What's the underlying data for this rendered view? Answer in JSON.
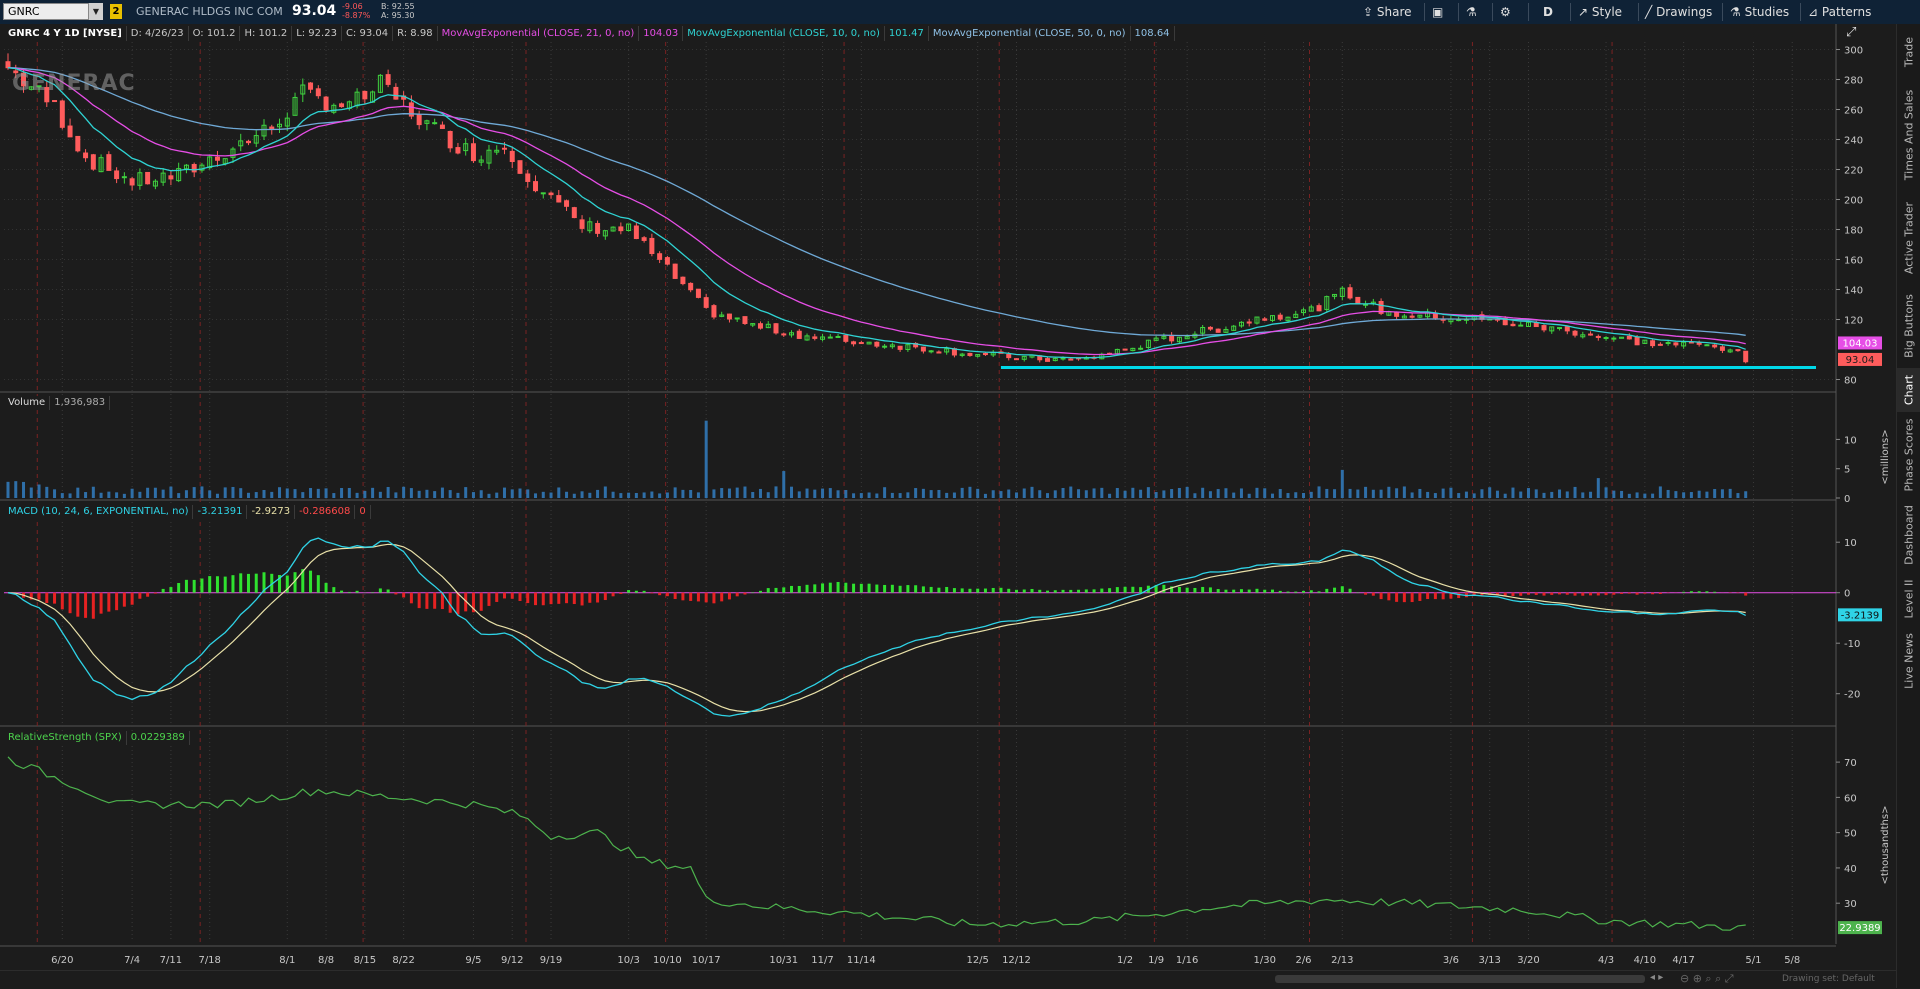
{
  "header": {
    "symbol": "GNRC",
    "link_badge": "2",
    "company": "GENERAC HLDGS INC COM",
    "last": "93.04",
    "net_change": "-9.06",
    "pct_change": "-8.87%",
    "bid": "B: 92.55",
    "ask": "A: 95.30",
    "buttons": {
      "share": "Share",
      "style": "Style",
      "drawings": "Drawings",
      "studies": "Studies",
      "patterns": "Patterns",
      "aggregation": "D"
    }
  },
  "infobar": {
    "title": "GNRC 4 Y 1D [NYSE]",
    "date": "D: 4/26/23",
    "open": "O: 101.2",
    "high": "H: 101.2",
    "low": "L: 92.23",
    "close": "C: 93.04",
    "range": "R: 8.98",
    "ema21_name": "MovAvgExponential (CLOSE, 21, 0, no)",
    "ema21_val": "104.03",
    "ema10_name": "MovAvgExponential (CLOSE, 10, 0, no)",
    "ema10_val": "101.47",
    "ema50_name": "MovAvgExponential (CLOSE, 50, 0, no)",
    "ema50_val": "108.64"
  },
  "logo_text": "GENERAC",
  "colors": {
    "up": "#3fd23f",
    "down": "#ff5c5c",
    "ema10": "#2fd3d3",
    "ema21": "#e64ee6",
    "ema50": "#6fa9d6",
    "volume": "#2f6fa8",
    "macd": "#2fd3e6",
    "signal": "#e8e0a8",
    "rs": "#4db34d",
    "support": "#00d8e8"
  },
  "price_axis": {
    "ticks": [
      "300",
      "280",
      "260",
      "240",
      "220",
      "200",
      "180",
      "160",
      "140",
      "120",
      "80"
    ],
    "badges": {
      "ema21": "104.03",
      "last": "93.04"
    }
  },
  "volume_panel": {
    "label": "Volume",
    "value": "1,936,983",
    "ticks": [
      "10",
      "5",
      "0"
    ],
    "unit": "<millions>"
  },
  "macd_panel": {
    "label": "MACD (10, 24, 6, EXPONENTIAL, no)",
    "macd": "-3.21391",
    "signal": "-2.9273",
    "diff": "-0.286608",
    "zero": "0",
    "ticks": [
      "10",
      "0",
      "-10",
      "-20"
    ],
    "badge": "-3.2139"
  },
  "rs_panel": {
    "label": "RelativeStrength (SPX)",
    "value": "0.0229389",
    "ticks": [
      "70",
      "60",
      "50",
      "40",
      "30"
    ],
    "unit": "<thousandths>",
    "badge": "22.9389"
  },
  "x_axis": {
    "labels": [
      "6/20",
      "7/4",
      "7/11",
      "7/18",
      "8/1",
      "8/8",
      "8/15",
      "8/22",
      "9/5",
      "9/12",
      "9/19",
      "10/3",
      "10/10",
      "10/17",
      "10/31",
      "11/7",
      "11/14",
      "12/5",
      "12/12",
      "1/2",
      "1/9",
      "1/16",
      "1/30",
      "2/6",
      "2/13",
      "3/6",
      "3/13",
      "3/20",
      "4/3",
      "4/10",
      "4/17",
      "5/1",
      "5/8"
    ]
  },
  "sidebar": {
    "tabs": [
      "Trade",
      "Times And Sales",
      "Active Trader",
      "Big Buttons",
      "Chart",
      "Phase Scores",
      "Dashboard",
      "Level II",
      "Live News"
    ],
    "active": "Chart"
  },
  "footer": {
    "drawing_set": "Drawing set: Default"
  }
}
